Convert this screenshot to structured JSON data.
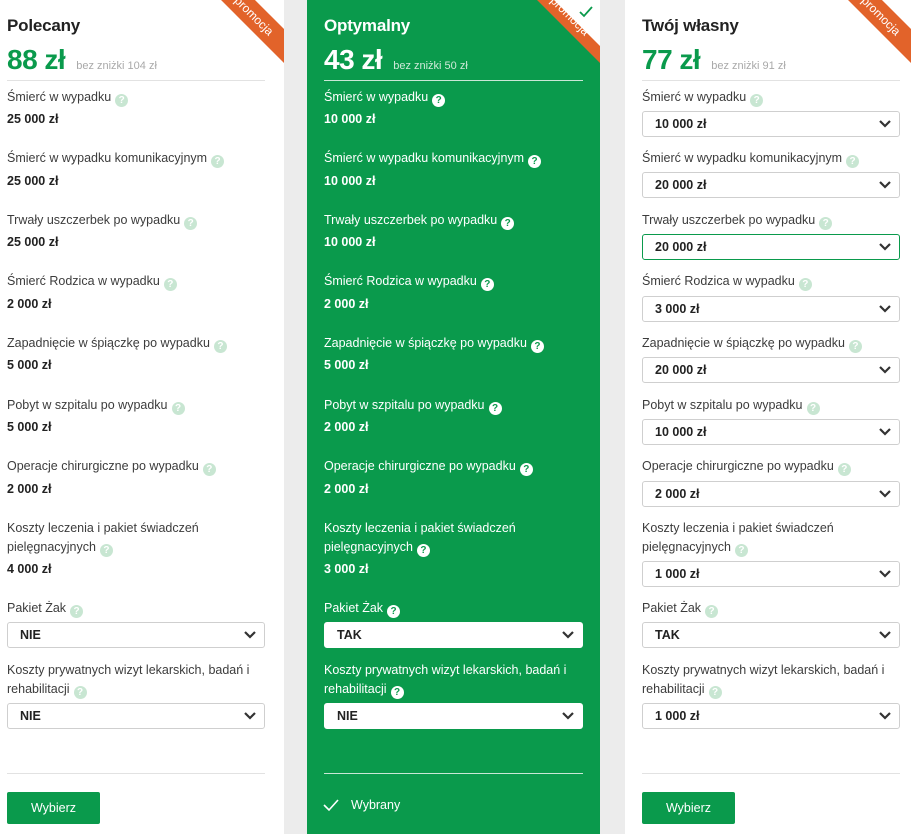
{
  "colors": {
    "green": "#0a9a4c",
    "orange": "#e2632a"
  },
  "cards": [
    {
      "title": "Polecany",
      "price": "88 zł",
      "old_price": "bez zniżki 104 zł",
      "ribbon": "promocja",
      "rows": [
        {
          "label": "Śmierć w wypadku",
          "value": "25 000 zł"
        },
        {
          "label": "Śmierć w wypadku komunikacyjnym",
          "value": "25 000 zł"
        },
        {
          "label": "Trwały uszczerbek po wypadku",
          "value": "25 000 zł"
        },
        {
          "label": "Śmierć Rodzica w wypadku",
          "value": "2 000 zł"
        },
        {
          "label": "Zapadnięcie w śpiączkę po wypadku",
          "value": "5 000 zł"
        },
        {
          "label": "Pobyt w szpitalu po wypadku",
          "value": "5 000 zł"
        },
        {
          "label": "Operacje chirurgiczne po wypadku",
          "value": "2 000 zł"
        },
        {
          "label": "Koszty leczenia i pakiet świadczeń",
          "label2": "pielęgnacyjnych",
          "value": "4 000 zł"
        },
        {
          "label": "Pakiet Żak",
          "value": "NIE"
        },
        {
          "label": "Koszty prywatnych wizyt lekarskich, badań i",
          "label2": "rehabilitacji",
          "value": "NIE"
        }
      ],
      "button": "Wybierz"
    },
    {
      "title": "Optymalny",
      "price": "43 zł",
      "old_price": "bez zniżki 50 zł",
      "ribbon": "promocja",
      "rows": [
        {
          "label": "Śmierć w wypadku",
          "value": "10 000 zł"
        },
        {
          "label": "Śmierć w wypadku komunikacyjnym",
          "value": "10 000 zł"
        },
        {
          "label": "Trwały uszczerbek po wypadku",
          "value": "10 000 zł"
        },
        {
          "label": "Śmierć Rodzica w wypadku",
          "value": "2 000 zł"
        },
        {
          "label": "Zapadnięcie w śpiączkę po wypadku",
          "value": "5 000 zł"
        },
        {
          "label": "Pobyt w szpitalu po wypadku",
          "value": "2 000 zł"
        },
        {
          "label": "Operacje chirurgiczne po wypadku",
          "value": "2 000 zł"
        },
        {
          "label": "Koszty leczenia i pakiet świadczeń",
          "label2": "pielęgnacyjnych",
          "value": "3 000 zł"
        },
        {
          "label": "Pakiet Żak",
          "value": "TAK"
        },
        {
          "label": "Koszty prywatnych wizyt lekarskich, badań i",
          "label2": "rehabilitacji",
          "value": "NIE"
        }
      ],
      "chosen": "Wybrany"
    },
    {
      "title": "Twój własny",
      "price": "77 zł",
      "old_price": "bez zniżki 91 zł",
      "ribbon": "promocja",
      "rows": [
        {
          "label": "Śmierć w wypadku",
          "value": "10 000 zł"
        },
        {
          "label": "Śmierć w wypadku komunikacyjnym",
          "value": "20 000 zł"
        },
        {
          "label": "Trwały uszczerbek po wypadku",
          "value": "20 000 zł"
        },
        {
          "label": "Śmierć Rodzica w wypadku",
          "value": "3 000 zł"
        },
        {
          "label": "Zapadnięcie w śpiączkę po wypadku",
          "value": "20 000 zł"
        },
        {
          "label": "Pobyt w szpitalu po wypadku",
          "value": "10 000 zł"
        },
        {
          "label": "Operacje chirurgiczne po wypadku",
          "value": "2 000 zł"
        },
        {
          "label": "Koszty leczenia i pakiet świadczeń",
          "label2": "pielęgnacyjnych",
          "value": "1 000 zł"
        },
        {
          "label": "Pakiet Żak",
          "value": "TAK"
        },
        {
          "label": "Koszty prywatnych wizyt lekarskich, badań i",
          "label2": "rehabilitacji",
          "value": "1 000 zł"
        }
      ],
      "button": "Wybierz"
    }
  ]
}
